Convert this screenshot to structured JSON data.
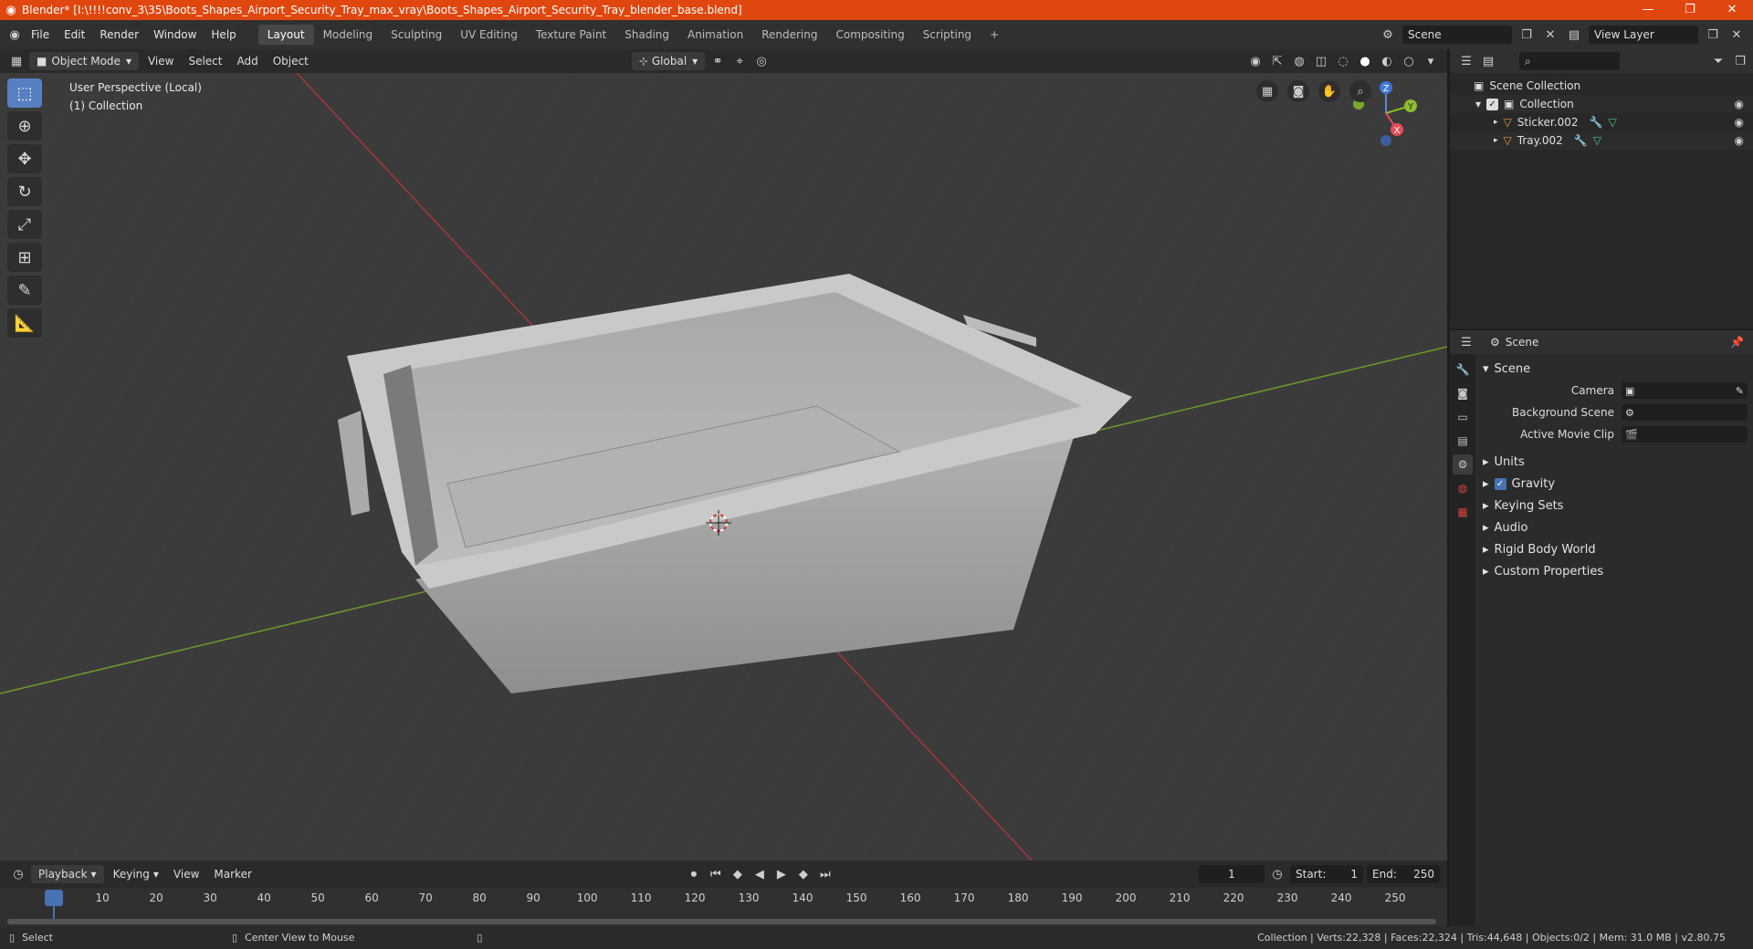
{
  "window": {
    "title": "Blender* [I:\\!!!!conv_3\\35\\Boots_Shapes_Airport_Security_Tray_max_vray\\Boots_Shapes_Airport_Security_Tray_blender_base.blend]",
    "controls": [
      "—",
      "❐",
      "✕"
    ]
  },
  "menubar": {
    "menus": [
      "File",
      "Edit",
      "Render",
      "Window",
      "Help"
    ],
    "workspaces": [
      "Layout",
      "Modeling",
      "Sculpting",
      "UV Editing",
      "Texture Paint",
      "Shading",
      "Animation",
      "Rendering",
      "Compositing",
      "Scripting"
    ],
    "active_workspace": "Layout",
    "add_tab": "+",
    "scene_name": "Scene",
    "view_layer": "View Layer"
  },
  "viewport_header": {
    "mode": "Object Mode",
    "menus": [
      "View",
      "Select",
      "Add",
      "Object"
    ],
    "orientation": "Global"
  },
  "viewport": {
    "info_line1": "User Perspective (Local)",
    "info_line2": "(1) Collection",
    "gizmo": {
      "x": "X",
      "y": "Y",
      "z": "Z"
    }
  },
  "toolbar": {
    "tools": [
      "select-box",
      "cursor",
      "move",
      "rotate",
      "scale",
      "transform",
      "annotate",
      "measure"
    ]
  },
  "outliner": {
    "root": "Scene Collection",
    "collection": "Collection",
    "objects": [
      "Sticker.002",
      "Tray.002"
    ]
  },
  "properties": {
    "context": "Scene",
    "panel": "Scene",
    "fields": [
      {
        "label": "Camera",
        "value": ""
      },
      {
        "label": "Background Scene",
        "value": ""
      },
      {
        "label": "Active Movie Clip",
        "value": ""
      }
    ],
    "subpanels": [
      "Units",
      "Gravity",
      "Keying Sets",
      "Audio",
      "Rigid Body World",
      "Custom Properties"
    ],
    "gravity_checked": true
  },
  "timeline": {
    "menus": [
      "Playback",
      "Keying",
      "View",
      "Marker"
    ],
    "current_frame": "1",
    "start_label": "Start:",
    "start": "1",
    "end_label": "End:",
    "end": "250",
    "ticks": [
      "1",
      "10",
      "20",
      "30",
      "40",
      "50",
      "60",
      "70",
      "80",
      "90",
      "100",
      "110",
      "120",
      "130",
      "140",
      "150",
      "160",
      "170",
      "180",
      "190",
      "200",
      "210",
      "220",
      "230",
      "240",
      "250"
    ]
  },
  "statusbar": {
    "left": "Select",
    "middle": "Center View to Mouse",
    "right": "Collection | Verts:22,328 | Faces:22,324 | Tris:44,648 | Objects:0/2 | Mem: 31.0 MB | v2.80.75"
  },
  "colors": {
    "titlebar": "#e0470f",
    "accent": "#4772b3",
    "x_axis": "#a8353b",
    "y_axis": "#6c9a2b"
  }
}
